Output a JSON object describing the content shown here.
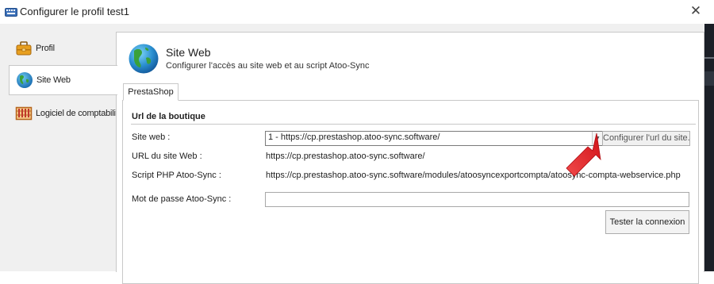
{
  "window": {
    "title": "Configurer le profil test1",
    "icons": [
      "keyboard-icon",
      "close-icon"
    ]
  },
  "sidebar": {
    "items": [
      {
        "label": "Profil",
        "icon": "briefcase-icon",
        "active": false
      },
      {
        "label": "Site Web",
        "icon": "globe-icon",
        "active": true
      },
      {
        "label": "Logiciel de comptabilité",
        "icon": "abacus-icon",
        "active": false
      }
    ]
  },
  "header": {
    "title": "Site Web",
    "subtitle": "Configurer l'accès au site web et au script Atoo-Sync",
    "icon": "globe-icon"
  },
  "tabs": [
    {
      "label": "PrestaShop",
      "active": true
    }
  ],
  "form": {
    "group_title": "Url de la boutique",
    "site_label": "Site web :",
    "site_value": "1 - https://cp.prestashop.atoo-sync.software/",
    "configure_button": "Configurer l'url du site...",
    "url_label": "URL du site Web :",
    "url_value": "https://cp.prestashop.atoo-sync.software/",
    "script_label": "Script PHP Atoo-Sync :",
    "script_value": "https://cp.prestashop.atoo-sync.software/modules/atoosyncexportcompta/atoosync-compta-webservice.php",
    "password_label": "Mot de passe Atoo-Sync :",
    "password_value": "",
    "test_button": "Tester la connexion"
  },
  "colors": {
    "annotation_arrow": "#e8191f",
    "window_bg": "#f0f0f0",
    "panel_bg": "#ffffff"
  }
}
